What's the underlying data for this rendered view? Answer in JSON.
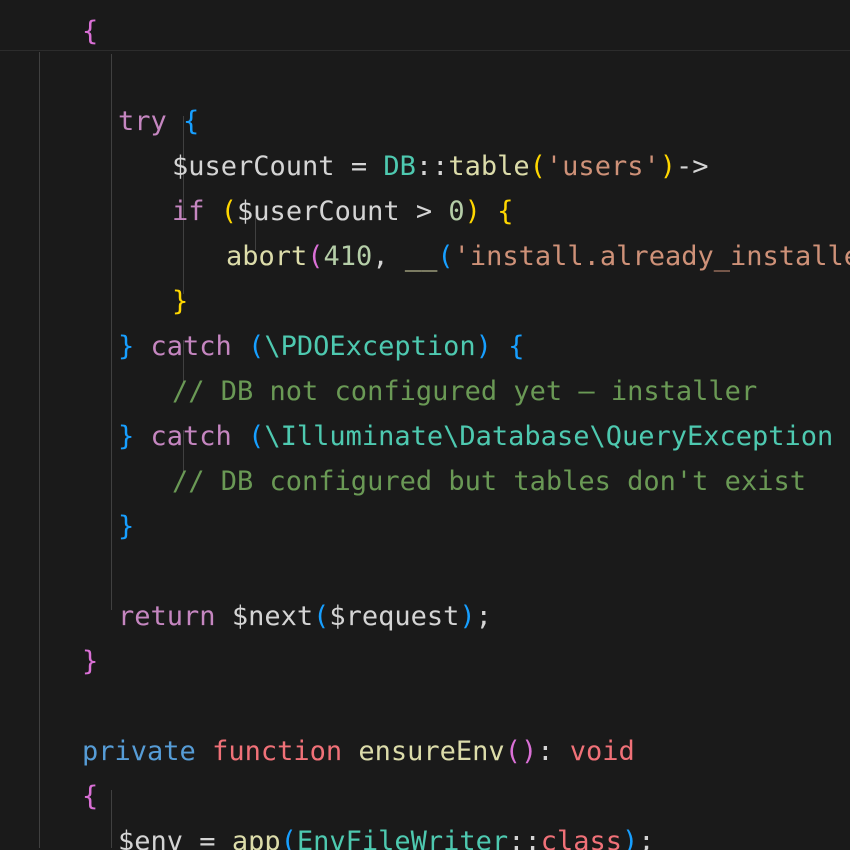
{
  "editor": {
    "colors": {
      "background": "#1a1a1a",
      "text": "#d4d4d4",
      "keyword_control": "#c586c0",
      "keyword_storage": "#569cd6",
      "keyword_function": "#f07178",
      "function": "#dcdcaa",
      "string": "#ce9178",
      "number": "#b5cea8",
      "type": "#4ec9b0",
      "comment": "#6a9955",
      "bracket_gold": "#ffd700",
      "bracket_pink": "#da70d6",
      "bracket_blue": "#179fff",
      "indent_guide": "#404040"
    },
    "lines": [
      {
        "indent": 4,
        "tokens": [
          {
            "t": "{",
            "c": "#da70d6"
          }
        ]
      },
      {
        "indent": 0,
        "tokens": []
      },
      {
        "indent": 6,
        "tokens": [
          {
            "t": "try",
            "c": "#c586c0"
          },
          {
            "t": " ",
            "c": "#d4d4d4"
          },
          {
            "t": "{",
            "c": "#179fff"
          }
        ]
      },
      {
        "indent": 9,
        "tokens": [
          {
            "t": "$userCount",
            "c": "#d4d4d4"
          },
          {
            "t": " = ",
            "c": "#d4d4d4"
          },
          {
            "t": "DB",
            "c": "#4ec9b0"
          },
          {
            "t": "::",
            "c": "#d4d4d4"
          },
          {
            "t": "table",
            "c": "#dcdcaa"
          },
          {
            "t": "(",
            "c": "#ffd700"
          },
          {
            "t": "'users'",
            "c": "#ce9178"
          },
          {
            "t": ")",
            "c": "#ffd700"
          },
          {
            "t": "->",
            "c": "#d4d4d4"
          }
        ]
      },
      {
        "indent": 9,
        "tokens": [
          {
            "t": "if",
            "c": "#c586c0"
          },
          {
            "t": " ",
            "c": "#d4d4d4"
          },
          {
            "t": "(",
            "c": "#ffd700"
          },
          {
            "t": "$userCount",
            "c": "#d4d4d4"
          },
          {
            "t": " > ",
            "c": "#d4d4d4"
          },
          {
            "t": "0",
            "c": "#b5cea8"
          },
          {
            "t": ")",
            "c": "#ffd700"
          },
          {
            "t": " ",
            "c": "#d4d4d4"
          },
          {
            "t": "{",
            "c": "#ffd700"
          }
        ]
      },
      {
        "indent": 12,
        "tokens": [
          {
            "t": "abort",
            "c": "#dcdcaa"
          },
          {
            "t": "(",
            "c": "#da70d6"
          },
          {
            "t": "410",
            "c": "#b5cea8"
          },
          {
            "t": ", ",
            "c": "#d4d4d4"
          },
          {
            "t": "__",
            "c": "#dcdcaa"
          },
          {
            "t": "(",
            "c": "#179fff"
          },
          {
            "t": "'install.already_installed'",
            "c": "#ce9178"
          }
        ]
      },
      {
        "indent": 9,
        "tokens": [
          {
            "t": "}",
            "c": "#ffd700"
          }
        ]
      },
      {
        "indent": 6,
        "tokens": [
          {
            "t": "}",
            "c": "#179fff"
          },
          {
            "t": " ",
            "c": "#d4d4d4"
          },
          {
            "t": "catch",
            "c": "#c586c0"
          },
          {
            "t": " ",
            "c": "#d4d4d4"
          },
          {
            "t": "(",
            "c": "#179fff"
          },
          {
            "t": "\\PDOException",
            "c": "#4ec9b0"
          },
          {
            "t": ")",
            "c": "#179fff"
          },
          {
            "t": " ",
            "c": "#d4d4d4"
          },
          {
            "t": "{",
            "c": "#179fff"
          }
        ]
      },
      {
        "indent": 9,
        "tokens": [
          {
            "t": "// DB not configured yet — installer",
            "c": "#6a9955"
          }
        ]
      },
      {
        "indent": 6,
        "tokens": [
          {
            "t": "}",
            "c": "#179fff"
          },
          {
            "t": " ",
            "c": "#d4d4d4"
          },
          {
            "t": "catch",
            "c": "#c586c0"
          },
          {
            "t": " ",
            "c": "#d4d4d4"
          },
          {
            "t": "(",
            "c": "#179fff"
          },
          {
            "t": "\\Illuminate\\Database\\QueryException",
            "c": "#4ec9b0"
          }
        ]
      },
      {
        "indent": 9,
        "tokens": [
          {
            "t": "// DB configured but tables don't exist",
            "c": "#6a9955"
          }
        ]
      },
      {
        "indent": 6,
        "tokens": [
          {
            "t": "}",
            "c": "#179fff"
          }
        ]
      },
      {
        "indent": 0,
        "tokens": []
      },
      {
        "indent": 6,
        "tokens": [
          {
            "t": "return",
            "c": "#c586c0"
          },
          {
            "t": " ",
            "c": "#d4d4d4"
          },
          {
            "t": "$next",
            "c": "#d4d4d4"
          },
          {
            "t": "(",
            "c": "#179fff"
          },
          {
            "t": "$request",
            "c": "#d4d4d4"
          },
          {
            "t": ")",
            "c": "#179fff"
          },
          {
            "t": ";",
            "c": "#d4d4d4"
          }
        ]
      },
      {
        "indent": 4,
        "tokens": [
          {
            "t": "}",
            "c": "#da70d6"
          }
        ]
      },
      {
        "indent": 0,
        "tokens": []
      },
      {
        "indent": 4,
        "tokens": [
          {
            "t": "private",
            "c": "#569cd6"
          },
          {
            "t": " ",
            "c": "#d4d4d4"
          },
          {
            "t": "function",
            "c": "#f07178"
          },
          {
            "t": " ",
            "c": "#d4d4d4"
          },
          {
            "t": "ensureEnv",
            "c": "#dcdcaa"
          },
          {
            "t": "(",
            "c": "#da70d6"
          },
          {
            "t": ")",
            "c": "#da70d6"
          },
          {
            "t": ": ",
            "c": "#d4d4d4"
          },
          {
            "t": "void",
            "c": "#f07178"
          }
        ]
      },
      {
        "indent": 4,
        "tokens": [
          {
            "t": "{",
            "c": "#da70d6"
          }
        ]
      },
      {
        "indent": 6,
        "tokens": [
          {
            "t": "$env",
            "c": "#d4d4d4"
          },
          {
            "t": " = ",
            "c": "#d4d4d4"
          },
          {
            "t": "app",
            "c": "#dcdcaa"
          },
          {
            "t": "(",
            "c": "#179fff"
          },
          {
            "t": "EnvFileWriter",
            "c": "#4ec9b0"
          },
          {
            "t": "::",
            "c": "#d4d4d4"
          },
          {
            "t": "class",
            "c": "#f07178"
          },
          {
            "t": ")",
            "c": "#179fff"
          },
          {
            "t": ";",
            "c": "#d4d4d4"
          }
        ]
      }
    ]
  }
}
